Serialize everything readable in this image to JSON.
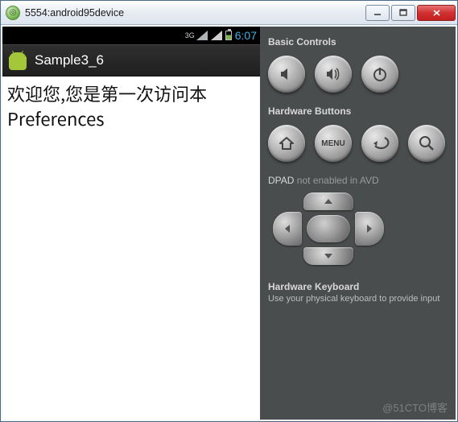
{
  "window": {
    "title": "5554:android95device",
    "controls": {
      "min": "—",
      "max": "▢",
      "close": "✕"
    }
  },
  "phone": {
    "status": {
      "network_type": "3G",
      "time": "6:07"
    },
    "header": {
      "app_title": "Sample3_6"
    },
    "content_text": "欢迎您,您是第一次访问本Preferences"
  },
  "controls": {
    "basic": {
      "title": "Basic Controls",
      "buttons": {
        "vol_down": "volume-down",
        "vol_up": "volume-up",
        "power": "power"
      }
    },
    "hardware": {
      "title": "Hardware Buttons",
      "buttons": {
        "home": "home",
        "menu": "MENU",
        "back": "back",
        "search": "search"
      }
    },
    "dpad": {
      "title": "DPAD",
      "status": "not enabled in AVD"
    },
    "keyboard": {
      "title": "Hardware Keyboard",
      "subtitle": "Use your physical keyboard to provide input"
    }
  },
  "watermark": "@51CTO博客"
}
